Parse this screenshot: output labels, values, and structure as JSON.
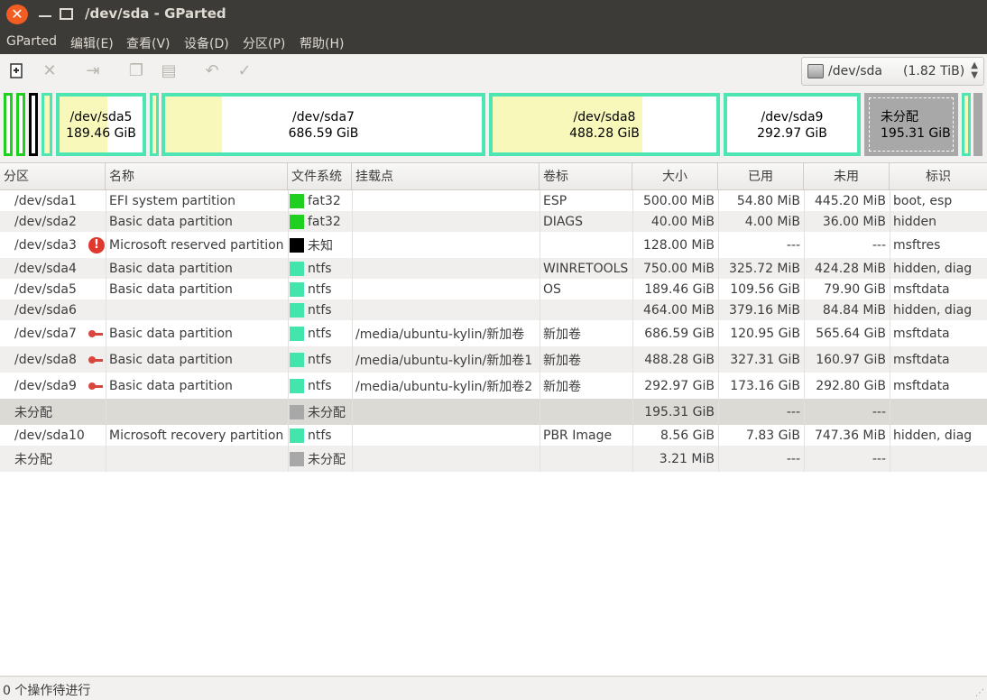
{
  "window": {
    "title": "/dev/sda - GParted"
  },
  "menu": [
    "GParted",
    "编辑(E)",
    "查看(V)",
    "设备(D)",
    "分区(P)",
    "帮助(H)"
  ],
  "toolbar": {
    "icons": [
      "new-partition-icon",
      "delete-icon",
      "resize-move-icon",
      "copy-icon",
      "paste-icon",
      "undo-icon",
      "apply-icon"
    ]
  },
  "device": {
    "name": "/dev/sda",
    "size": "(1.82 TiB)"
  },
  "partition_map": [
    {
      "name": "/dev/sda5",
      "size": "189.46 GiB",
      "used_fraction": 0.58
    },
    {
      "name": "/dev/sda7",
      "size": "686.59 GiB",
      "used_fraction": 0.18
    },
    {
      "name": "/dev/sda8",
      "size": "488.28 GiB",
      "used_fraction": 0.67
    },
    {
      "name": "/dev/sda9",
      "size": "292.97 GiB",
      "used_fraction": 0.0
    },
    {
      "name": "未分配",
      "size": "195.31 GiB",
      "used_fraction": 0.0
    }
  ],
  "columns": [
    "分区",
    "名称",
    "文件系统",
    "挂载点",
    "卷标",
    "大小",
    "已用",
    "未用",
    "标识"
  ],
  "rows": [
    {
      "partition": "/dev/sda1",
      "name": "EFI system partition",
      "fs": "fat32",
      "fs_color": "#20d020",
      "mount": "",
      "label": "ESP",
      "size": "500.00 MiB",
      "used": "54.80 MiB",
      "unused": "445.20 MiB",
      "flags": "boot, esp",
      "icon": ""
    },
    {
      "partition": "/dev/sda2",
      "name": "Basic data partition",
      "fs": "fat32",
      "fs_color": "#20d020",
      "mount": "",
      "label": "DIAGS",
      "size": "40.00 MiB",
      "used": "4.00 MiB",
      "unused": "36.00 MiB",
      "flags": "hidden",
      "icon": ""
    },
    {
      "partition": "/dev/sda3",
      "name": "Microsoft reserved partition",
      "fs": "未知",
      "fs_color": "#000000",
      "mount": "",
      "label": "",
      "size": "128.00 MiB",
      "used": "---",
      "unused": "---",
      "flags": "msftres",
      "icon": "warning-icon"
    },
    {
      "partition": "/dev/sda4",
      "name": "Basic data partition",
      "fs": "ntfs",
      "fs_color": "#42e5ac",
      "mount": "",
      "label": "WINRETOOLS",
      "size": "750.00 MiB",
      "used": "325.72 MiB",
      "unused": "424.28 MiB",
      "flags": "hidden, diag",
      "icon": ""
    },
    {
      "partition": "/dev/sda5",
      "name": "Basic data partition",
      "fs": "ntfs",
      "fs_color": "#42e5ac",
      "mount": "",
      "label": "OS",
      "size": "189.46 GiB",
      "used": "109.56 GiB",
      "unused": "79.90 GiB",
      "flags": "msftdata",
      "icon": ""
    },
    {
      "partition": "/dev/sda6",
      "name": "",
      "fs": "ntfs",
      "fs_color": "#42e5ac",
      "mount": "",
      "label": "",
      "size": "464.00 MiB",
      "used": "379.16 MiB",
      "unused": "84.84 MiB",
      "flags": "hidden, diag",
      "icon": ""
    },
    {
      "partition": "/dev/sda7",
      "name": "Basic data partition",
      "fs": "ntfs",
      "fs_color": "#42e5ac",
      "mount": "/media/ubuntu-kylin/新加卷",
      "label": "新加卷",
      "size": "686.59 GiB",
      "used": "120.95 GiB",
      "unused": "565.64 GiB",
      "flags": "msftdata",
      "icon": "key-icon"
    },
    {
      "partition": "/dev/sda8",
      "name": "Basic data partition",
      "fs": "ntfs",
      "fs_color": "#42e5ac",
      "mount": "/media/ubuntu-kylin/新加卷1",
      "label": "新加卷",
      "size": "488.28 GiB",
      "used": "327.31 GiB",
      "unused": "160.97 GiB",
      "flags": "msftdata",
      "icon": "key-icon"
    },
    {
      "partition": "/dev/sda9",
      "name": "Basic data partition",
      "fs": "ntfs",
      "fs_color": "#42e5ac",
      "mount": "/media/ubuntu-kylin/新加卷2",
      "label": "新加卷",
      "size": "292.97 GiB",
      "used": "173.16 GiB",
      "unused": "292.80 GiB",
      "flags": "msftdata",
      "icon": "key-icon"
    },
    {
      "partition": "未分配",
      "name": "",
      "fs": "未分配",
      "fs_color": "#a8a8a8",
      "mount": "",
      "label": "",
      "size": "195.31 GiB",
      "used": "---",
      "unused": "---",
      "flags": "",
      "icon": "",
      "selected": true
    },
    {
      "partition": "/dev/sda10",
      "name": "Microsoft recovery partition",
      "fs": "ntfs",
      "fs_color": "#42e5ac",
      "mount": "",
      "label": "PBR Image",
      "size": "8.56 GiB",
      "used": "7.83 GiB",
      "unused": "747.36 MiB",
      "flags": "hidden, diag",
      "icon": ""
    },
    {
      "partition": "未分配",
      "name": "",
      "fs": "未分配",
      "fs_color": "#a8a8a8",
      "mount": "",
      "label": "",
      "size": "3.21 MiB",
      "used": "---",
      "unused": "---",
      "flags": "",
      "icon": ""
    }
  ],
  "status": {
    "text": "0 个操作待进行"
  }
}
